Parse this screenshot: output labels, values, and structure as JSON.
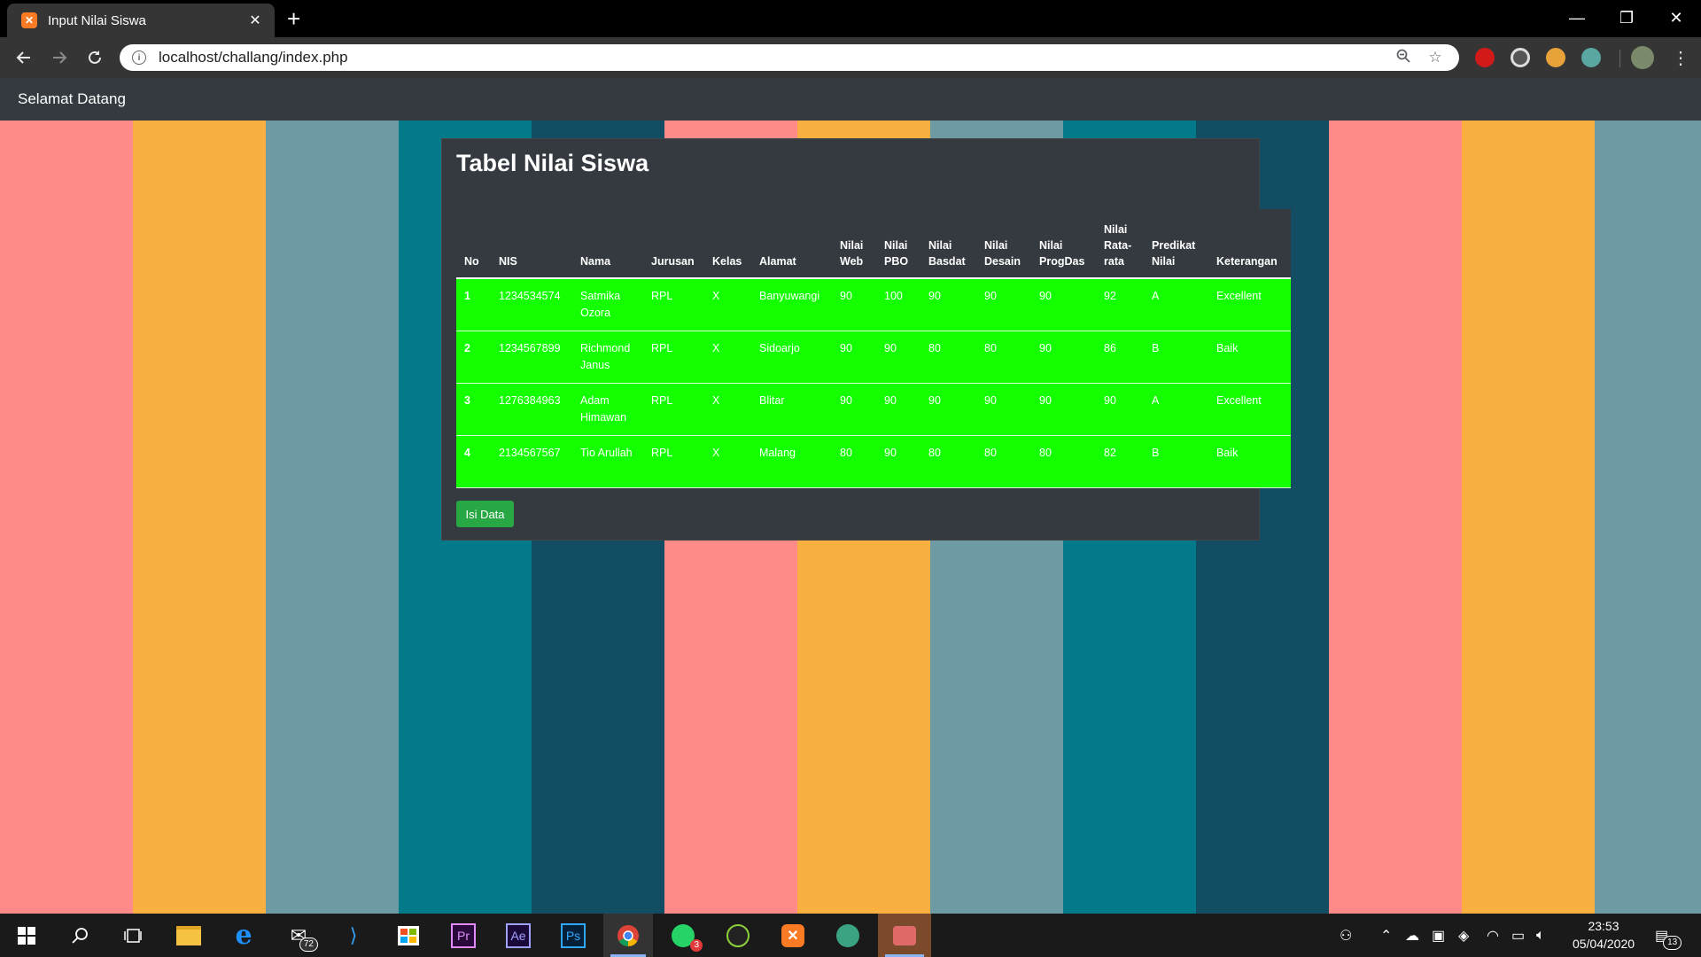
{
  "browser": {
    "tab_title": "Input Nilai Siswa",
    "tab_close": "✕",
    "new_tab": "+",
    "url": "localhost/challang/index.php",
    "window_controls": [
      "—",
      "❐",
      "✕"
    ]
  },
  "page": {
    "brand": "Selamat Datang",
    "title": "Tabel Nilai Siswa",
    "button_label": "Isi Data",
    "stripe_colors": [
      "#ff8a8a",
      "#f9b040",
      "#6e9aa4",
      "#027a89",
      "#134d63"
    ]
  },
  "table": {
    "headers": [
      "No",
      "NIS",
      "Nama",
      "Jurusan",
      "Kelas",
      "Alamat",
      "Nilai Web",
      "Nilai PBO",
      "Nilai Basdat",
      "Nilai Desain",
      "Nilai ProgDas",
      "Nilai Rata-rata",
      "Predikat Nilai",
      "Keterangan"
    ],
    "rows": [
      [
        "1",
        "1234534574",
        "Satmika Ozora",
        "RPL",
        "X",
        "Banyuwangi",
        "90",
        "100",
        "90",
        "90",
        "90",
        "92",
        "A",
        "Excellent"
      ],
      [
        "2",
        "1234567899",
        "Richmond Janus",
        "RPL",
        "X",
        "Sidoarjo",
        "90",
        "90",
        "80",
        "80",
        "90",
        "86",
        "B",
        "Baik"
      ],
      [
        "3",
        "1276384963",
        "Adam Himawan",
        "RPL",
        "X",
        "Blitar",
        "90",
        "90",
        "90",
        "90",
        "90",
        "90",
        "A",
        "Excellent"
      ],
      [
        "4",
        "2134567567",
        "Tio Arullah",
        "RPL",
        "X",
        "Malang",
        "80",
        "90",
        "80",
        "80",
        "80",
        "82",
        "B",
        "Baik"
      ]
    ],
    "row_color": "#14ff00"
  },
  "taskbar": {
    "mail_badge": "72",
    "whatsapp_badge": "3",
    "notification_badge": "13",
    "time": "23:53",
    "date": "05/04/2020"
  }
}
